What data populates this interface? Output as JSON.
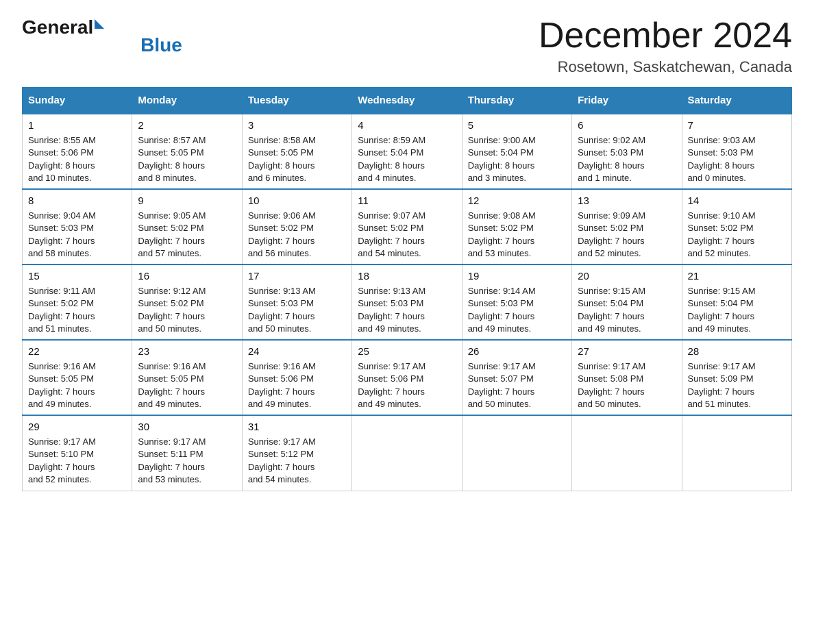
{
  "header": {
    "logo_general": "General",
    "logo_blue": "Blue",
    "title": "December 2024",
    "location": "Rosetown, Saskatchewan, Canada"
  },
  "days_of_week": [
    "Sunday",
    "Monday",
    "Tuesday",
    "Wednesday",
    "Thursday",
    "Friday",
    "Saturday"
  ],
  "weeks": [
    [
      {
        "day": "1",
        "sunrise": "8:55 AM",
        "sunset": "5:06 PM",
        "daylight": "8 hours and 10 minutes."
      },
      {
        "day": "2",
        "sunrise": "8:57 AM",
        "sunset": "5:05 PM",
        "daylight": "8 hours and 8 minutes."
      },
      {
        "day": "3",
        "sunrise": "8:58 AM",
        "sunset": "5:05 PM",
        "daylight": "8 hours and 6 minutes."
      },
      {
        "day": "4",
        "sunrise": "8:59 AM",
        "sunset": "5:04 PM",
        "daylight": "8 hours and 4 minutes."
      },
      {
        "day": "5",
        "sunrise": "9:00 AM",
        "sunset": "5:04 PM",
        "daylight": "8 hours and 3 minutes."
      },
      {
        "day": "6",
        "sunrise": "9:02 AM",
        "sunset": "5:03 PM",
        "daylight": "8 hours and 1 minute."
      },
      {
        "day": "7",
        "sunrise": "9:03 AM",
        "sunset": "5:03 PM",
        "daylight": "8 hours and 0 minutes."
      }
    ],
    [
      {
        "day": "8",
        "sunrise": "9:04 AM",
        "sunset": "5:03 PM",
        "daylight": "7 hours and 58 minutes."
      },
      {
        "day": "9",
        "sunrise": "9:05 AM",
        "sunset": "5:02 PM",
        "daylight": "7 hours and 57 minutes."
      },
      {
        "day": "10",
        "sunrise": "9:06 AM",
        "sunset": "5:02 PM",
        "daylight": "7 hours and 56 minutes."
      },
      {
        "day": "11",
        "sunrise": "9:07 AM",
        "sunset": "5:02 PM",
        "daylight": "7 hours and 54 minutes."
      },
      {
        "day": "12",
        "sunrise": "9:08 AM",
        "sunset": "5:02 PM",
        "daylight": "7 hours and 53 minutes."
      },
      {
        "day": "13",
        "sunrise": "9:09 AM",
        "sunset": "5:02 PM",
        "daylight": "7 hours and 52 minutes."
      },
      {
        "day": "14",
        "sunrise": "9:10 AM",
        "sunset": "5:02 PM",
        "daylight": "7 hours and 52 minutes."
      }
    ],
    [
      {
        "day": "15",
        "sunrise": "9:11 AM",
        "sunset": "5:02 PM",
        "daylight": "7 hours and 51 minutes."
      },
      {
        "day": "16",
        "sunrise": "9:12 AM",
        "sunset": "5:02 PM",
        "daylight": "7 hours and 50 minutes."
      },
      {
        "day": "17",
        "sunrise": "9:13 AM",
        "sunset": "5:03 PM",
        "daylight": "7 hours and 50 minutes."
      },
      {
        "day": "18",
        "sunrise": "9:13 AM",
        "sunset": "5:03 PM",
        "daylight": "7 hours and 49 minutes."
      },
      {
        "day": "19",
        "sunrise": "9:14 AM",
        "sunset": "5:03 PM",
        "daylight": "7 hours and 49 minutes."
      },
      {
        "day": "20",
        "sunrise": "9:15 AM",
        "sunset": "5:04 PM",
        "daylight": "7 hours and 49 minutes."
      },
      {
        "day": "21",
        "sunrise": "9:15 AM",
        "sunset": "5:04 PM",
        "daylight": "7 hours and 49 minutes."
      }
    ],
    [
      {
        "day": "22",
        "sunrise": "9:16 AM",
        "sunset": "5:05 PM",
        "daylight": "7 hours and 49 minutes."
      },
      {
        "day": "23",
        "sunrise": "9:16 AM",
        "sunset": "5:05 PM",
        "daylight": "7 hours and 49 minutes."
      },
      {
        "day": "24",
        "sunrise": "9:16 AM",
        "sunset": "5:06 PM",
        "daylight": "7 hours and 49 minutes."
      },
      {
        "day": "25",
        "sunrise": "9:17 AM",
        "sunset": "5:06 PM",
        "daylight": "7 hours and 49 minutes."
      },
      {
        "day": "26",
        "sunrise": "9:17 AM",
        "sunset": "5:07 PM",
        "daylight": "7 hours and 50 minutes."
      },
      {
        "day": "27",
        "sunrise": "9:17 AM",
        "sunset": "5:08 PM",
        "daylight": "7 hours and 50 minutes."
      },
      {
        "day": "28",
        "sunrise": "9:17 AM",
        "sunset": "5:09 PM",
        "daylight": "7 hours and 51 minutes."
      }
    ],
    [
      {
        "day": "29",
        "sunrise": "9:17 AM",
        "sunset": "5:10 PM",
        "daylight": "7 hours and 52 minutes."
      },
      {
        "day": "30",
        "sunrise": "9:17 AM",
        "sunset": "5:11 PM",
        "daylight": "7 hours and 53 minutes."
      },
      {
        "day": "31",
        "sunrise": "9:17 AM",
        "sunset": "5:12 PM",
        "daylight": "7 hours and 54 minutes."
      },
      null,
      null,
      null,
      null
    ]
  ],
  "labels": {
    "sunrise": "Sunrise:",
    "sunset": "Sunset:",
    "daylight": "Daylight:"
  }
}
